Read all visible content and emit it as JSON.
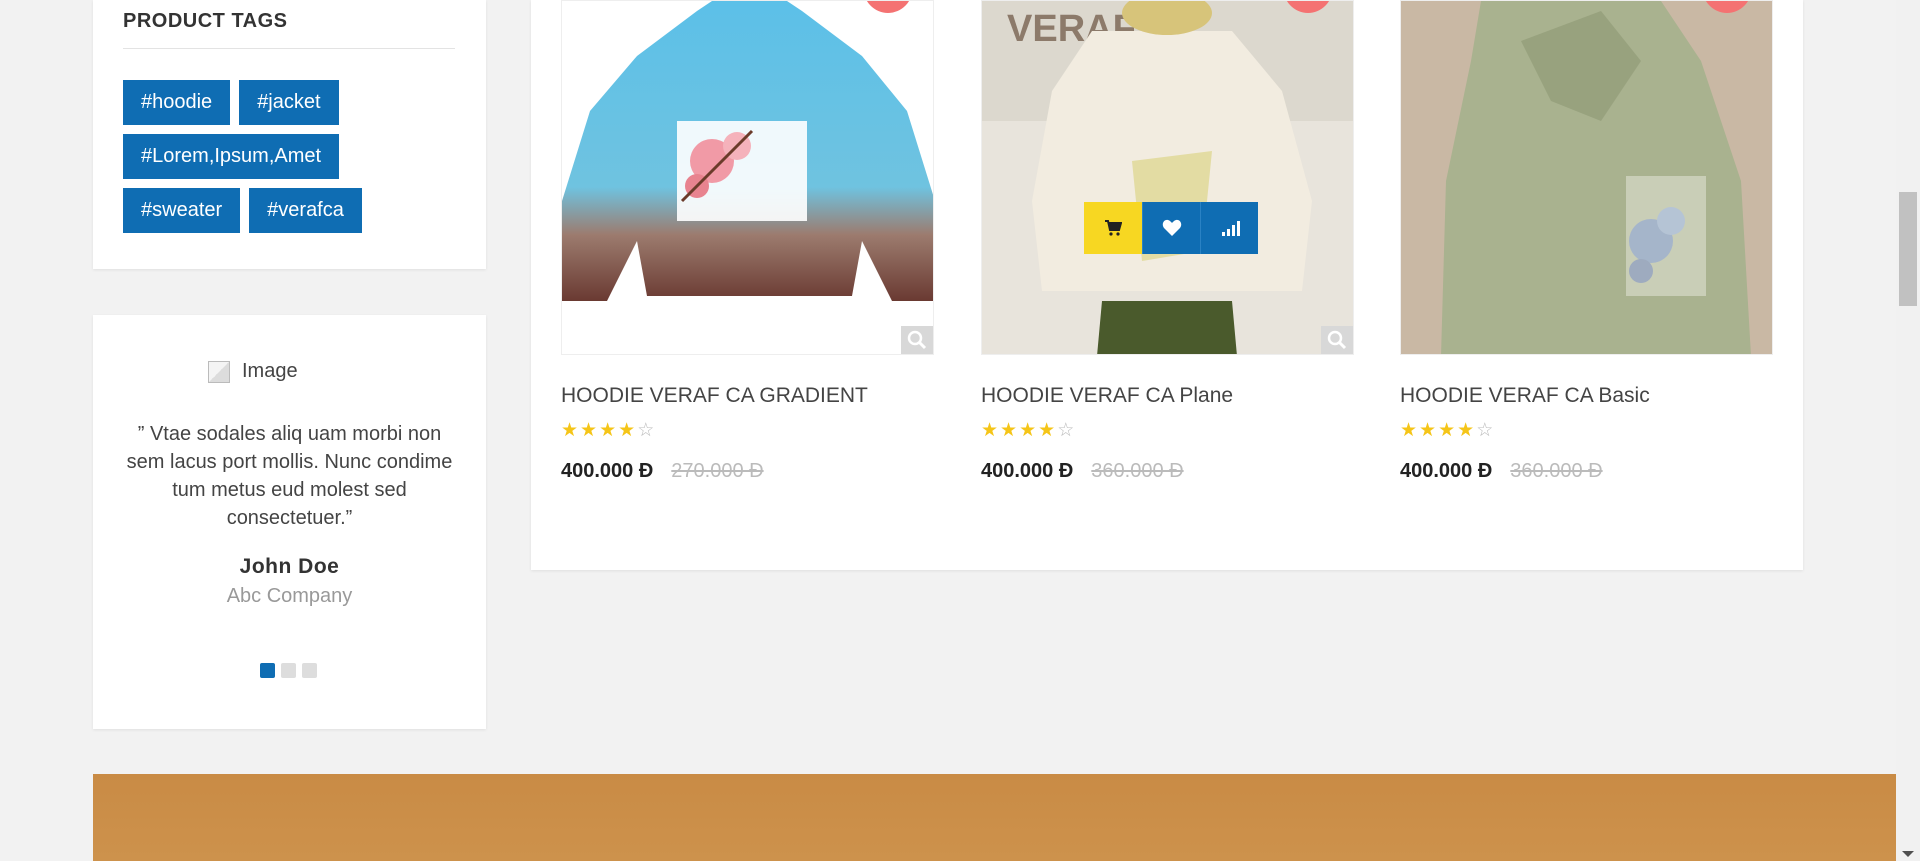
{
  "sidebar": {
    "tags_title": "PRODUCT TAGS",
    "tags": [
      "#hoodie",
      "#jacket",
      "#Lorem,Ipsum,Amet",
      "#sweater",
      "#verafca"
    ]
  },
  "testimonial": {
    "image_alt": "Image",
    "quote": "” Vtae sodales aliq uam morbi non sem lacus port mollis. Nunc condime tum metus eud molest sed consectetuer.”",
    "name": "John Doe",
    "company": "Abc Company",
    "slides": 3,
    "active_slide": 1
  },
  "products": [
    {
      "name": "HOODIE VERAF CA GRADIENT",
      "rating": 4,
      "price": "400.000 Đ",
      "old_price": "270.000 Đ"
    },
    {
      "name": "HOODIE VERAF CA Plane",
      "rating": 4,
      "price": "400.000 Đ",
      "old_price": "360.000 Đ"
    },
    {
      "name": "HOODIE VERAF CA Basic",
      "rating": 4,
      "price": "400.000 Đ",
      "old_price": "360.000 Đ"
    }
  ],
  "colors": {
    "accent": "#0f6db3",
    "cart_button": "#f7d722",
    "sale_badge": "#f47272",
    "banner": "#c98b45"
  },
  "icons": {
    "cart": "cart-icon",
    "wishlist": "heart-icon",
    "compare": "signal-bars-icon",
    "zoom": "magnifier-icon"
  }
}
